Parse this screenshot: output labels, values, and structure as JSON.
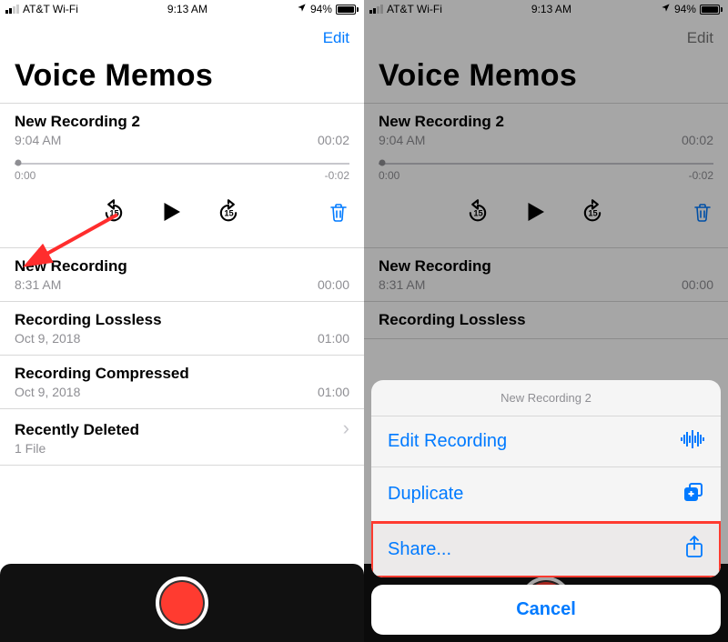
{
  "status": {
    "carrier": "AT&T Wi-Fi",
    "time": "9:13 AM",
    "battery_pct": "94%"
  },
  "nav": {
    "edit": "Edit"
  },
  "title": "Voice Memos",
  "selected": {
    "name": "New Recording 2",
    "time": "9:04 AM",
    "duration": "00:02",
    "scrub_pos": "0:00",
    "scrub_remaining": "-0:02"
  },
  "items": [
    {
      "name": "New Recording",
      "time": "8:31 AM",
      "duration": "00:00"
    },
    {
      "name": "Recording Lossless",
      "time": "Oct 9, 2018",
      "duration": "01:00"
    },
    {
      "name": "Recording Compressed",
      "time": "Oct 9, 2018",
      "duration": "01:00"
    }
  ],
  "recently_deleted": {
    "label": "Recently Deleted",
    "sub": "1 File"
  },
  "right_truncated": {
    "name": "Recording Lossless"
  },
  "sheet": {
    "title": "New Recording 2",
    "edit": "Edit Recording",
    "duplicate": "Duplicate",
    "share": "Share...",
    "cancel": "Cancel"
  }
}
